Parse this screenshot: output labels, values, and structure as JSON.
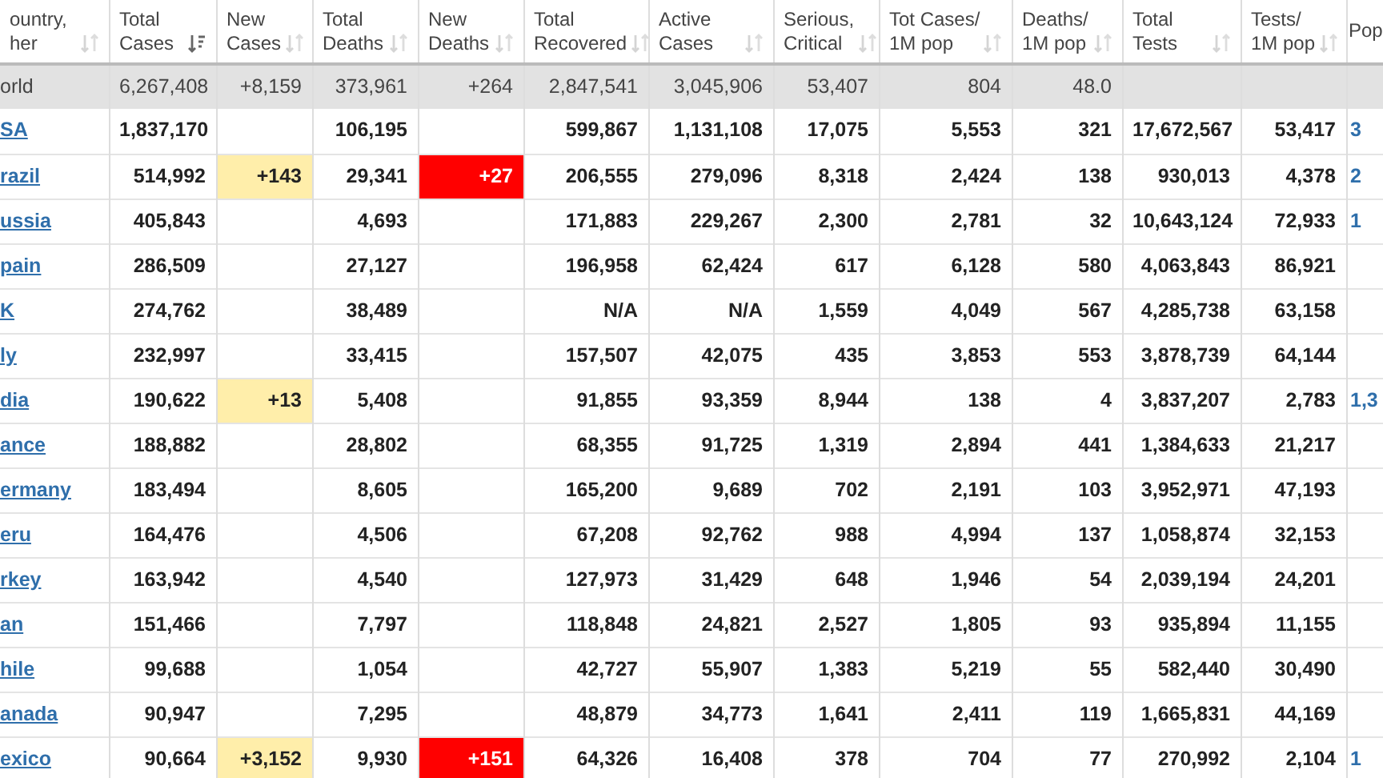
{
  "table": {
    "columns": [
      {
        "label": "ountry,\nher",
        "kind": "name",
        "sorted": false
      },
      {
        "label": "Total\nCases",
        "kind": "number",
        "sorted": true
      },
      {
        "label": "New\nCases",
        "kind": "new_cases",
        "sorted": false
      },
      {
        "label": "Total\nDeaths",
        "kind": "number",
        "sorted": false
      },
      {
        "label": "New\nDeaths",
        "kind": "new_deaths",
        "sorted": false
      },
      {
        "label": "Total\nRecovered",
        "kind": "number",
        "sorted": false
      },
      {
        "label": "Active\nCases",
        "kind": "number",
        "sorted": false
      },
      {
        "label": "Serious,\nCritical",
        "kind": "number",
        "sorted": false
      },
      {
        "label": "Tot Cases/\n1M pop",
        "kind": "number",
        "sorted": false
      },
      {
        "label": "Deaths/\n1M pop",
        "kind": "number",
        "sorted": false
      },
      {
        "label": "Total\nTests",
        "kind": "number",
        "sorted": false
      },
      {
        "label": "Tests/\n1M pop",
        "kind": "number",
        "sorted": false
      },
      {
        "label": "Pop",
        "kind": "population"
      }
    ],
    "rows": [
      {
        "kind": "total",
        "cells": [
          "orld",
          "6,267,408",
          "+8,159",
          "373,961",
          "+264",
          "2,847,541",
          "3,045,906",
          "53,407",
          "804",
          "48.0",
          null,
          null,
          null
        ]
      },
      {
        "kind": "country",
        "cells": [
          "SA",
          "1,837,170",
          null,
          "106,195",
          null,
          "599,867",
          "1,131,108",
          "17,075",
          "5,553",
          "321",
          "17,672,567",
          "53,417",
          "3"
        ]
      },
      {
        "kind": "country",
        "cells": [
          "razil",
          "514,992",
          "+143",
          "29,341",
          "+27",
          "206,555",
          "279,096",
          "8,318",
          "2,424",
          "138",
          "930,013",
          "4,378",
          "2"
        ]
      },
      {
        "kind": "country",
        "cells": [
          "ussia",
          "405,843",
          null,
          "4,693",
          null,
          "171,883",
          "229,267",
          "2,300",
          "2,781",
          "32",
          "10,643,124",
          "72,933",
          "1"
        ]
      },
      {
        "kind": "country",
        "cells": [
          "pain",
          "286,509",
          null,
          "27,127",
          null,
          "196,958",
          "62,424",
          "617",
          "6,128",
          "580",
          "4,063,843",
          "86,921",
          null
        ]
      },
      {
        "kind": "country",
        "cells": [
          "K",
          "274,762",
          null,
          "38,489",
          null,
          "N/A",
          "N/A",
          "1,559",
          "4,049",
          "567",
          "4,285,738",
          "63,158",
          null
        ]
      },
      {
        "kind": "country",
        "cells": [
          "ly",
          "232,997",
          null,
          "33,415",
          null,
          "157,507",
          "42,075",
          "435",
          "3,853",
          "553",
          "3,878,739",
          "64,144",
          null
        ]
      },
      {
        "kind": "country",
        "cells": [
          "dia",
          "190,622",
          "+13",
          "5,408",
          null,
          "91,855",
          "93,359",
          "8,944",
          "138",
          "4",
          "3,837,207",
          "2,783",
          "1,3"
        ]
      },
      {
        "kind": "country",
        "cells": [
          "ance",
          "188,882",
          null,
          "28,802",
          null,
          "68,355",
          "91,725",
          "1,319",
          "2,894",
          "441",
          "1,384,633",
          "21,217",
          null
        ]
      },
      {
        "kind": "country",
        "cells": [
          "ermany",
          "183,494",
          null,
          "8,605",
          null,
          "165,200",
          "9,689",
          "702",
          "2,191",
          "103",
          "3,952,971",
          "47,193",
          null
        ]
      },
      {
        "kind": "country",
        "cells": [
          "eru",
          "164,476",
          null,
          "4,506",
          null,
          "67,208",
          "92,762",
          "988",
          "4,994",
          "137",
          "1,058,874",
          "32,153",
          null
        ]
      },
      {
        "kind": "country",
        "cells": [
          "rkey",
          "163,942",
          null,
          "4,540",
          null,
          "127,973",
          "31,429",
          "648",
          "1,946",
          "54",
          "2,039,194",
          "24,201",
          null
        ]
      },
      {
        "kind": "country",
        "cells": [
          "an",
          "151,466",
          null,
          "7,797",
          null,
          "118,848",
          "24,821",
          "2,527",
          "1,805",
          "93",
          "935,894",
          "11,155",
          null
        ]
      },
      {
        "kind": "country",
        "cells": [
          "hile",
          "99,688",
          null,
          "1,054",
          null,
          "42,727",
          "55,907",
          "1,383",
          "5,219",
          "55",
          "582,440",
          "30,490",
          null
        ]
      },
      {
        "kind": "country",
        "cells": [
          "anada",
          "90,947",
          null,
          "7,295",
          null,
          "48,879",
          "34,773",
          "1,641",
          "2,411",
          "119",
          "1,665,831",
          "44,169",
          null
        ]
      },
      {
        "kind": "country",
        "cells": [
          "exico",
          "90,664",
          "+3,152",
          "9,930",
          "+151",
          "64,326",
          "16,408",
          "378",
          "704",
          "77",
          "270,992",
          "2,104",
          "1"
        ]
      }
    ]
  }
}
